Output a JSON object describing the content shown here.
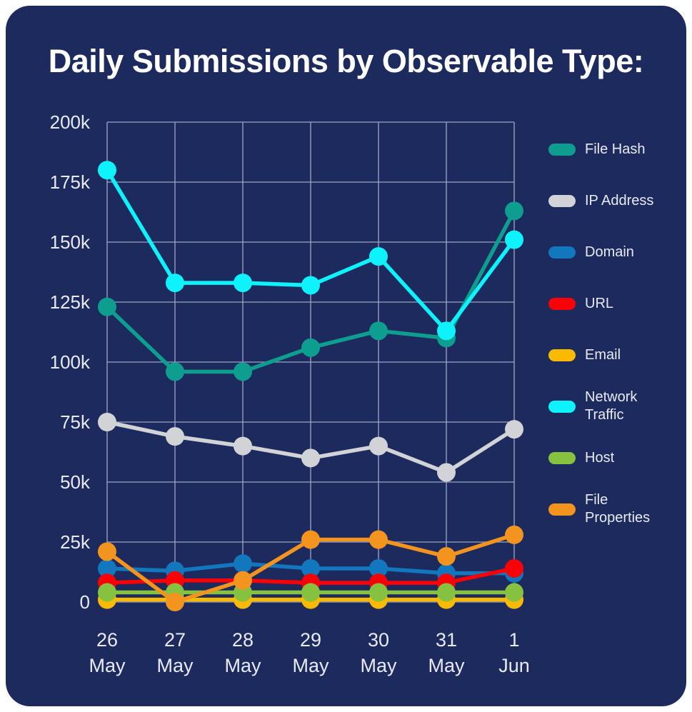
{
  "card": {
    "background_color": "#1d2a5e",
    "page_background_color": "#ffffff"
  },
  "header": {
    "title": "Daily Submissions by Observable Type:"
  },
  "axis": {
    "y_ticks": [
      "0",
      "25k",
      "50k",
      "75k",
      "100k",
      "125k",
      "150k",
      "175k",
      "200k"
    ],
    "x_ticks": [
      {
        "day": "26",
        "month": "May"
      },
      {
        "day": "27",
        "month": "May"
      },
      {
        "day": "28",
        "month": "May"
      },
      {
        "day": "29",
        "month": "May"
      },
      {
        "day": "30",
        "month": "May"
      },
      {
        "day": "31",
        "month": "May"
      },
      {
        "day": "1",
        "month": "Jun"
      }
    ]
  },
  "legend": {
    "position": "right",
    "items": [
      {
        "label": "File Hash",
        "color": "#0d9e8f"
      },
      {
        "label": "IP Address",
        "color": "#d2d3d6"
      },
      {
        "label": "Domain",
        "color": "#1277bd"
      },
      {
        "label": "URL",
        "color": "#fb0007"
      },
      {
        "label": "Email",
        "color": "#fbb900"
      },
      {
        "label": "Network Traffic",
        "color": "#0ef3fb"
      },
      {
        "label": "Host",
        "color": "#86c240"
      },
      {
        "label": "File Properties",
        "color": "#f3941f"
      }
    ]
  },
  "chart_data": {
    "type": "line",
    "title": "Daily Submissions by Observable Type:",
    "xlabel": "",
    "ylabel": "",
    "ylim": [
      0,
      200000
    ],
    "ytick_values": [
      0,
      25000,
      50000,
      75000,
      100000,
      125000,
      150000,
      175000,
      200000
    ],
    "ytick_labels": [
      "0",
      "25k",
      "50k",
      "75k",
      "100k",
      "125k",
      "150k",
      "175k",
      "200k"
    ],
    "grid": true,
    "legend_position": "right",
    "categories": [
      "26 May",
      "27 May",
      "28 May",
      "29 May",
      "30 May",
      "31 May",
      "1 Jun"
    ],
    "series": [
      {
        "name": "File Hash",
        "color": "#0d9e8f",
        "values": [
          123000,
          96000,
          96000,
          106000,
          113000,
          110000,
          163000
        ]
      },
      {
        "name": "IP Address",
        "color": "#d2d3d6",
        "values": [
          75000,
          69000,
          65000,
          60000,
          65000,
          54000,
          72000
        ]
      },
      {
        "name": "Domain",
        "color": "#1277bd",
        "values": [
          14000,
          13000,
          16000,
          14000,
          14000,
          12000,
          12000
        ]
      },
      {
        "name": "URL",
        "color": "#fb0007",
        "values": [
          8000,
          9000,
          9000,
          8000,
          8000,
          8000,
          14000
        ]
      },
      {
        "name": "Email",
        "color": "#fbb900",
        "values": [
          1000,
          1000,
          1000,
          1000,
          1000,
          1000,
          1000
        ]
      },
      {
        "name": "Network Traffic",
        "color": "#0ef3fb",
        "values": [
          180000,
          133000,
          133000,
          132000,
          144000,
          113000,
          151000
        ]
      },
      {
        "name": "Host",
        "color": "#86c240",
        "values": [
          4000,
          4000,
          4000,
          4000,
          4000,
          4000,
          4000
        ]
      },
      {
        "name": "File Properties",
        "color": "#f3941f",
        "values": [
          21000,
          0,
          9000,
          26000,
          26000,
          19000,
          28000
        ]
      }
    ]
  }
}
